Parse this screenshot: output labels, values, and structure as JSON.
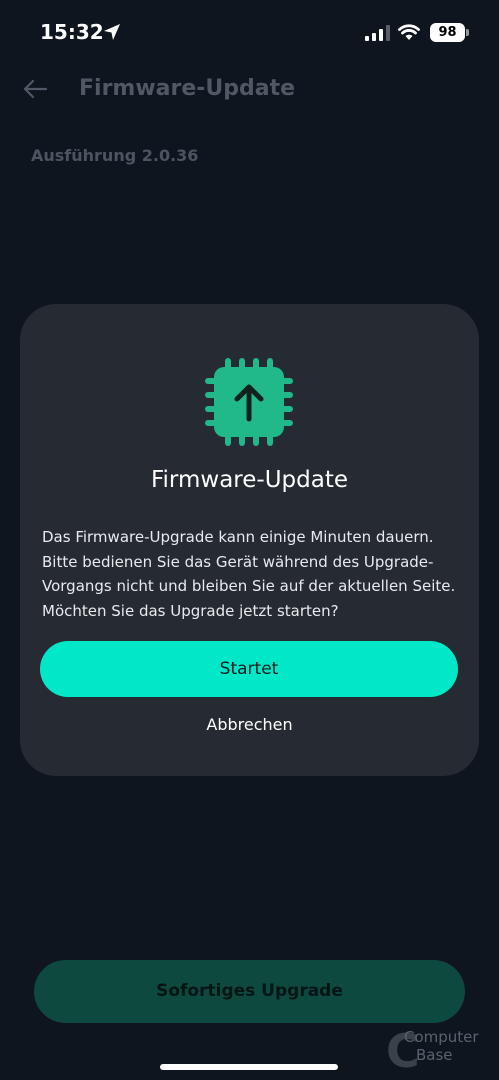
{
  "status_bar": {
    "time": "15:32",
    "battery": "98"
  },
  "page": {
    "title": "Firmware-Update",
    "version": "Ausführung 2.0.36",
    "upgrade_button": "Sofortiges Upgrade"
  },
  "dialog": {
    "icon": "chip-upload-icon",
    "title": "Firmware-Update",
    "message": "Das Firmware-Upgrade kann einige Minuten dauern. Bitte bedienen Sie das Gerät während des Upgrade-Vorgangs nicht und bleiben Sie auf der aktuellen Seite. Möchten Sie das Upgrade jetzt starten?",
    "confirm_label": "Startet",
    "cancel_label": "Abbrechen"
  },
  "watermark": {
    "letter": "C",
    "line1": "Computer",
    "line2": "Base"
  },
  "colors": {
    "background": "#0f151e",
    "dialog": "#252a33",
    "accent": "#00e8c8",
    "accent_dim": "#0e4940"
  }
}
